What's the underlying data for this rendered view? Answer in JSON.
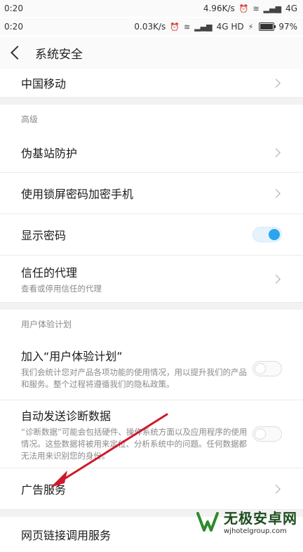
{
  "status_bar_top": {
    "time": "0:20",
    "speed": "4.96K/s",
    "network": "4G"
  },
  "status_bar": {
    "time": "0:20",
    "speed": "0.03K/s",
    "network": "4G HD",
    "battery": "97%",
    "battery_level": 0.97
  },
  "header": {
    "title": "系统安全"
  },
  "rows": {
    "carrier": {
      "title": "中国移动"
    },
    "section_advanced": "高级",
    "fake_base": {
      "title": "伪基站防护"
    },
    "lockscreen_encrypt": {
      "title": "使用锁屏密码加密手机"
    },
    "show_password": {
      "title": "显示密码",
      "state": "on"
    },
    "trusted_agents": {
      "title": "信任的代理",
      "subtitle": "查看或停用信任的代理"
    },
    "section_ux": "用户体验计划",
    "join_ux": {
      "title": "加入“用户体验计划”",
      "subtitle": "我们会统计您对产品各项功能的使用情况，用以提升我们的产品和服务。整个过程将遵循我们的隐私政策。",
      "state": "off"
    },
    "auto_diag": {
      "title": "自动发送诊断数据",
      "subtitle": "“诊断数据”可能会包括硬件、操作系统方面以及应用程序的使用情况。这些数据将被用来定位、分析系统中的问题。任何数据都无法用来识别您的身份。",
      "state": "off"
    },
    "ad_service": {
      "title": "广告服务"
    },
    "web_link": {
      "title": "网页链接调用服务"
    }
  },
  "colors": {
    "accent": "#2ca4ef",
    "annotation_arrow": "#d0182a"
  },
  "icons": {
    "back": "back-arrow-icon",
    "chevron": "chevron-right-icon",
    "wifi": "wifi-icon",
    "alarm": "alarm-icon",
    "signal": "signal-icon"
  },
  "watermark": {
    "name": "无极安卓网",
    "url": "wjhotelgroup.com"
  }
}
